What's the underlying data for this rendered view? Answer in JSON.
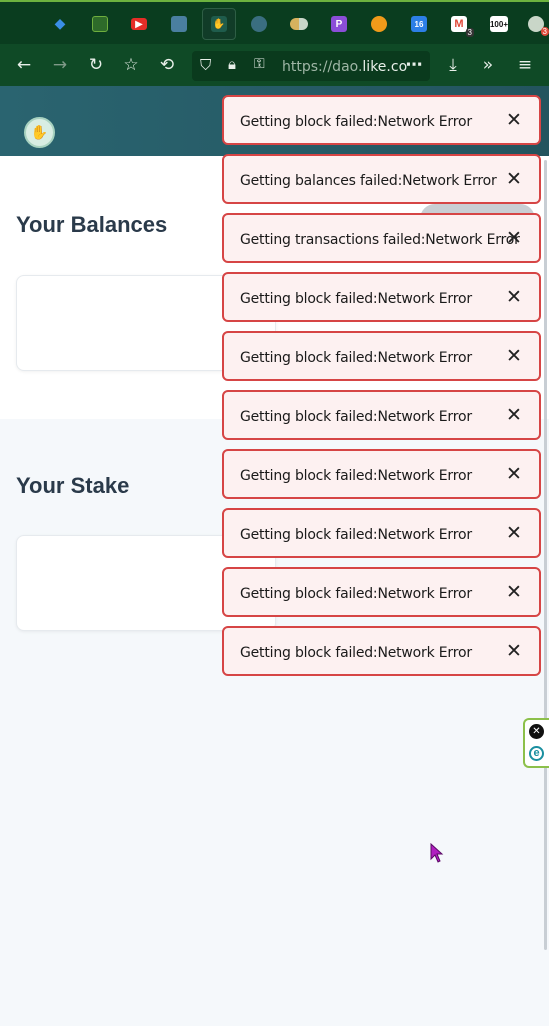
{
  "browser": {
    "url_prefix": "https://dao.",
    "url_domain": "like.co",
    "tabs": [
      {
        "name": "diamond-icon",
        "color": "#3a8ee6"
      },
      {
        "name": "calculator-icon",
        "color": "#6fae3e"
      },
      {
        "name": "youtube-icon",
        "color": "#e52d27"
      },
      {
        "name": "app-icon",
        "color": "#4a7fa0"
      },
      {
        "name": "likecoin-icon",
        "color": "#1f5c4c"
      },
      {
        "name": "clock-icon",
        "color": "#3a6e80"
      },
      {
        "name": "circles-icon",
        "color": "#d6b25e"
      },
      {
        "name": "purple-app-icon",
        "color": "#8b4ed8"
      },
      {
        "name": "orange-circle-icon",
        "color": "#f09a1a"
      },
      {
        "name": "calendar-icon",
        "color": "#2d7fe6"
      },
      {
        "name": "gmail-icon",
        "color": "#e04a3a"
      },
      {
        "name": "hundred-icon",
        "color": "#333333"
      },
      {
        "name": "chrome-icon",
        "color": "#e04a3a"
      }
    ],
    "tab_badges": {
      "calendar": "16",
      "gmail": "3",
      "hundred": "100+",
      "chrome": "3"
    }
  },
  "page": {
    "balances_title": "Your Balances",
    "stake_title": "Your Stake"
  },
  "toasts": [
    {
      "message": "Getting block failed:Network Error"
    },
    {
      "message": "Getting balances failed:Network Error"
    },
    {
      "message": "Getting transactions failed:Network Error"
    },
    {
      "message": "Getting block failed:Network Error"
    },
    {
      "message": "Getting block failed:Network Error"
    },
    {
      "message": "Getting block failed:Network Error"
    },
    {
      "message": "Getting block failed:Network Error"
    },
    {
      "message": "Getting block failed:Network Error"
    },
    {
      "message": "Getting block failed:Network Error"
    },
    {
      "message": "Getting block failed:Network Error"
    }
  ],
  "colors": {
    "toast_border": "#d64545",
    "toast_bg": "#fdf1f1",
    "header_bg": "#2a6470"
  }
}
